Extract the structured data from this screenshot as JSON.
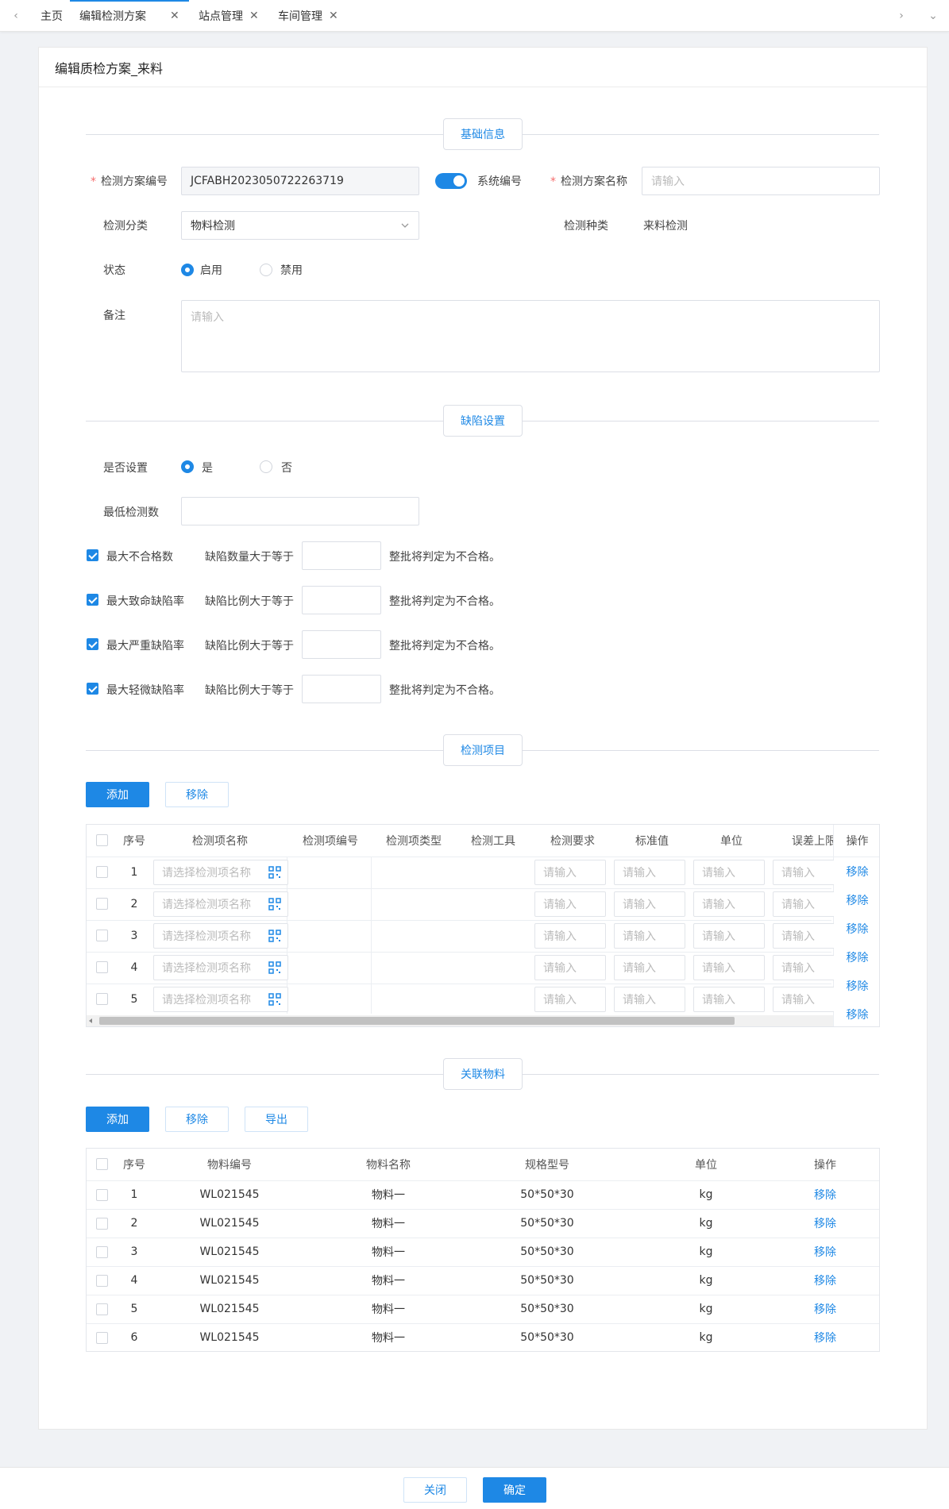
{
  "tabs": [
    {
      "label": "主页",
      "closable": false,
      "active": false
    },
    {
      "label": "编辑检测方案",
      "closable": true,
      "active": true
    },
    {
      "label": "站点管理",
      "closable": true,
      "active": false
    },
    {
      "label": "车间管理",
      "closable": true,
      "active": false
    }
  ],
  "nav": {
    "prev_icon": "‹",
    "next_icon": "›",
    "more_icon": "⌄",
    "close_icon": "✕"
  },
  "page": {
    "title": "编辑质检方案_来料"
  },
  "sections": {
    "basic": "基础信息",
    "defect": "缺陷设置",
    "items": "检测项目",
    "materials": "关联物料"
  },
  "basic": {
    "code_label": "检测方案编号",
    "code_value": "JCFABH2023050722263719",
    "auto_code_label": "系统编号",
    "auto_code_on": true,
    "name_label": "检测方案名称",
    "name_placeholder": "请输入",
    "category_label": "检测分类",
    "category_value": "物料检测",
    "type_label": "检测种类",
    "type_value": "来料检测",
    "status_label": "状态",
    "status_options": [
      "启用",
      "禁用"
    ],
    "status_selected": "启用",
    "remark_label": "备注",
    "remark_placeholder": "请输入"
  },
  "defect": {
    "enable_label": "是否设置",
    "enable_options": [
      "是",
      "否"
    ],
    "enable_selected": "是",
    "min_count_label": "最低检测数",
    "rules": [
      {
        "checked": true,
        "name": "最大不合格数",
        "condition": "缺陷数量大于等于",
        "suffix": "整批将判定为不合格。"
      },
      {
        "checked": true,
        "name": "最大致命缺陷率",
        "condition": "缺陷比例大于等于",
        "suffix": "整批将判定为不合格。"
      },
      {
        "checked": true,
        "name": "最大严重缺陷率",
        "condition": "缺陷比例大于等于",
        "suffix": "整批将判定为不合格。"
      },
      {
        "checked": true,
        "name": "最大轻微缺陷率",
        "condition": "缺陷比例大于等于",
        "suffix": "整批将判定为不合格。"
      }
    ]
  },
  "items": {
    "add_label": "添加",
    "remove_label": "移除",
    "columns": [
      "序号",
      "检测项名称",
      "检测项编号",
      "检测项类型",
      "检测工具",
      "检测要求",
      "标准值",
      "单位",
      "误差上限",
      "操作"
    ],
    "name_placeholder": "请选择检测项名称",
    "input_placeholder": "请输入",
    "row_action": "移除",
    "rows": [
      "1",
      "2",
      "3",
      "4",
      "5"
    ]
  },
  "materials": {
    "add_label": "添加",
    "remove_label": "移除",
    "export_label": "导出",
    "columns": [
      "序号",
      "物料编号",
      "物料名称",
      "规格型号",
      "单位",
      "操作"
    ],
    "row_action": "移除",
    "rows": [
      {
        "no": "1",
        "code": "WL021545",
        "name": "物料一",
        "spec": "50*50*30",
        "unit": "kg"
      },
      {
        "no": "2",
        "code": "WL021545",
        "name": "物料一",
        "spec": "50*50*30",
        "unit": "kg"
      },
      {
        "no": "3",
        "code": "WL021545",
        "name": "物料一",
        "spec": "50*50*30",
        "unit": "kg"
      },
      {
        "no": "4",
        "code": "WL021545",
        "name": "物料一",
        "spec": "50*50*30",
        "unit": "kg"
      },
      {
        "no": "5",
        "code": "WL021545",
        "name": "物料一",
        "spec": "50*50*30",
        "unit": "kg"
      },
      {
        "no": "6",
        "code": "WL021545",
        "name": "物料一",
        "spec": "50*50*30",
        "unit": "kg"
      }
    ]
  },
  "footer": {
    "close_label": "关闭",
    "confirm_label": "确定"
  },
  "colors": {
    "accent": "#1e88e5",
    "required": "#f56c6c"
  }
}
